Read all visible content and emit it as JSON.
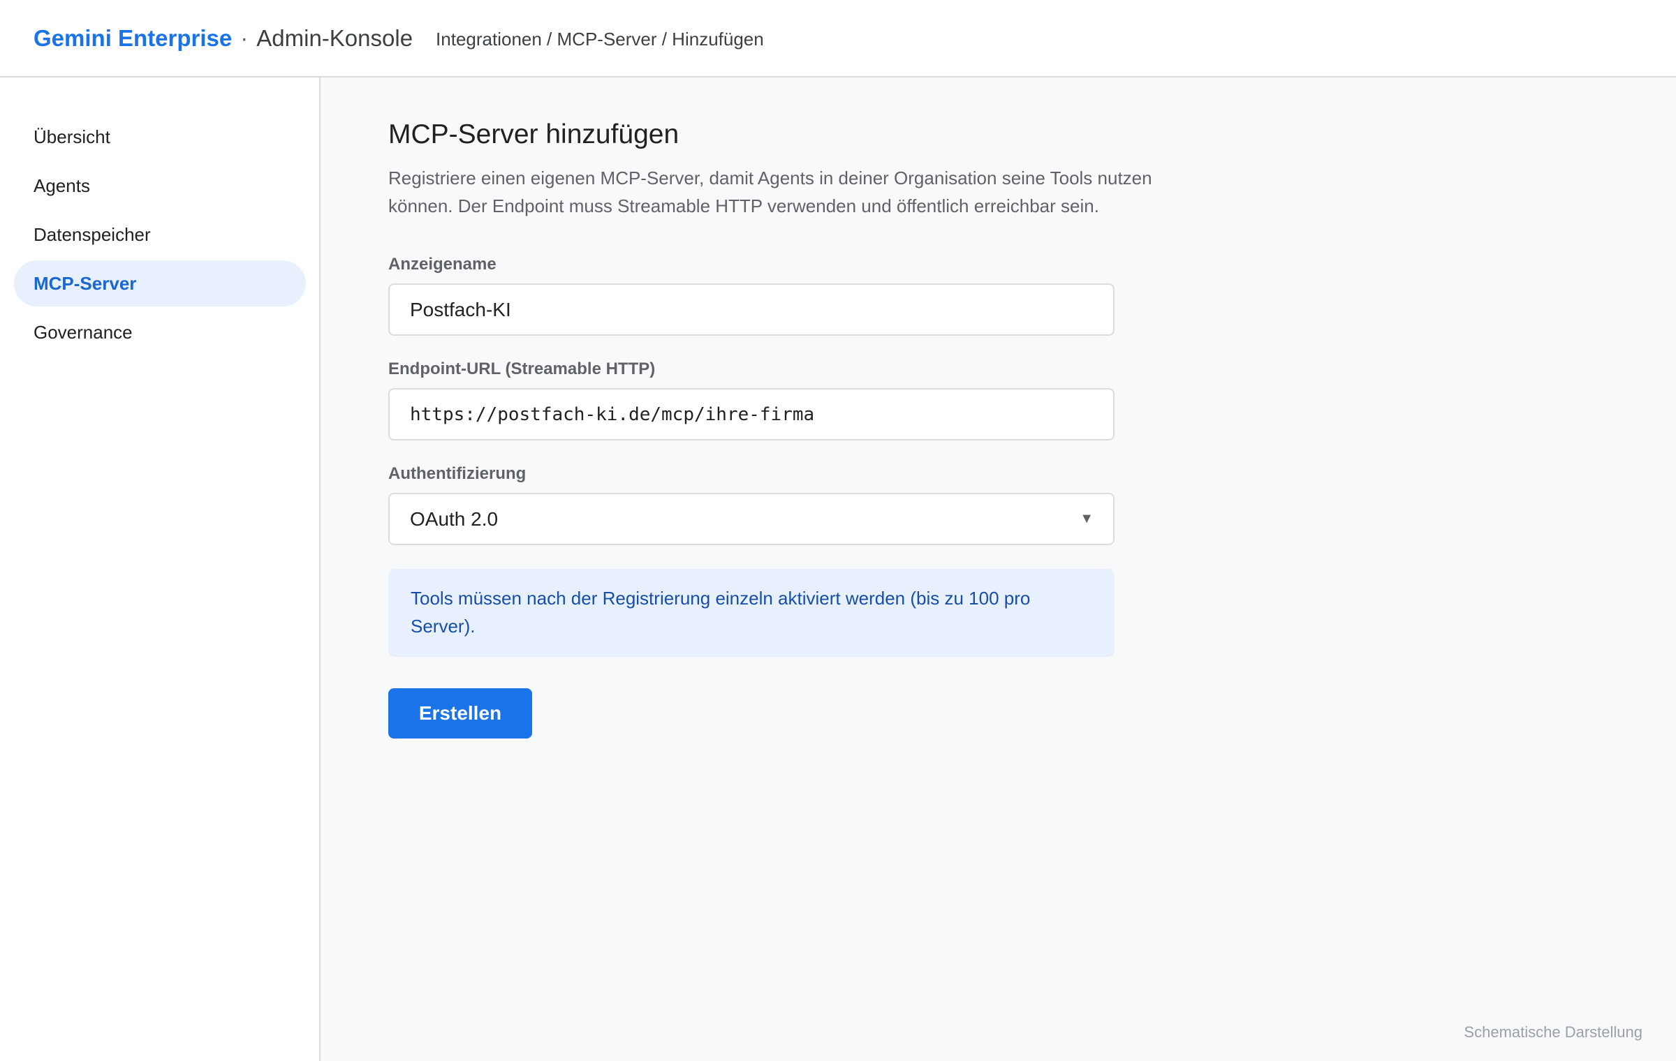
{
  "header": {
    "brand": "Gemini Enterprise",
    "separator": "·",
    "console": "Admin-Konsole",
    "breadcrumb": "Integrationen / MCP-Server / Hinzufügen"
  },
  "sidebar": {
    "items": [
      {
        "label": "Übersicht",
        "active": false
      },
      {
        "label": "Agents",
        "active": false
      },
      {
        "label": "Datenspeicher",
        "active": false
      },
      {
        "label": "MCP-Server",
        "active": true
      },
      {
        "label": "Governance",
        "active": false
      }
    ]
  },
  "main": {
    "title": "MCP-Server hinzufügen",
    "description": "Registriere einen eigenen MCP-Server, damit Agents in deiner Organisation seine Tools nutzen können. Der Endpoint muss Streamable HTTP verwenden und öffentlich erreichbar sein.",
    "fields": {
      "display_name": {
        "label": "Anzeigename",
        "value": "Postfach-KI"
      },
      "endpoint": {
        "label": "Endpoint-URL (Streamable HTTP)",
        "value": "https://postfach-ki.de/mcp/ihre-firma"
      },
      "auth": {
        "label": "Authentifizierung",
        "value": "OAuth 2.0"
      }
    },
    "info": "Tools müssen nach der Registrierung einzeln aktiviert werden (bis zu 100 pro Server).",
    "submit_label": "Erstellen"
  },
  "footnote": "Schematische Darstellung",
  "icons": {
    "select_arrow": "caret-down-icon"
  },
  "colors": {
    "accent": "#1a73e8",
    "active_bg": "#e8f0fe",
    "info_text": "#174ea6"
  }
}
